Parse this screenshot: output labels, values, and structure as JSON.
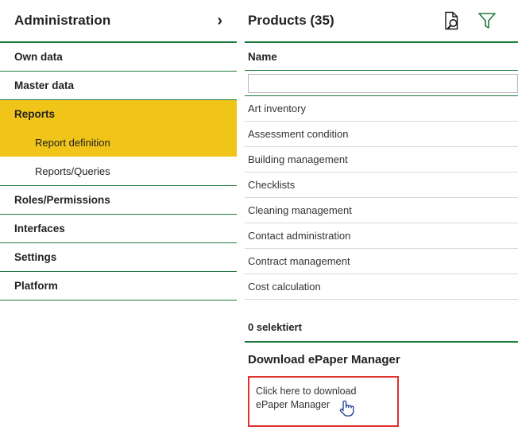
{
  "sidebar": {
    "title": "Administration",
    "expand_icon": "chevron-right-icon",
    "items": [
      {
        "label": "Own data",
        "type": "item",
        "active": false
      },
      {
        "label": "Master data",
        "type": "item",
        "active": false
      },
      {
        "label": "Reports",
        "type": "item",
        "active": true
      },
      {
        "label": "Report definition",
        "type": "sub",
        "active": true
      },
      {
        "label": "Reports/Queries",
        "type": "sub",
        "active": false
      },
      {
        "label": "Roles/Permissions",
        "type": "item",
        "active": false
      },
      {
        "label": "Interfaces",
        "type": "item",
        "active": false
      },
      {
        "label": "Settings",
        "type": "item",
        "active": false
      },
      {
        "label": "Platform",
        "type": "item",
        "active": false
      }
    ]
  },
  "content": {
    "title": "Products (35)",
    "icons": [
      {
        "name": "document-search-icon"
      },
      {
        "name": "filter-funnel-icon"
      }
    ],
    "column_header": "Name",
    "filter_placeholder": "",
    "filter_value": "",
    "rows": [
      "Art inventory",
      "Assessment condition",
      "Building management",
      "Checklists",
      "Cleaning management",
      "Contact administration",
      "Contract management",
      "Cost calculation"
    ],
    "selection_status": "0 selektiert",
    "download_section_title": "Download ePaper Manager",
    "download_link_text": "Click here to download ePaper Manager",
    "highlight_color": "#e03030",
    "accent_color": "#1f7a3d",
    "active_color": "#f0c419"
  }
}
